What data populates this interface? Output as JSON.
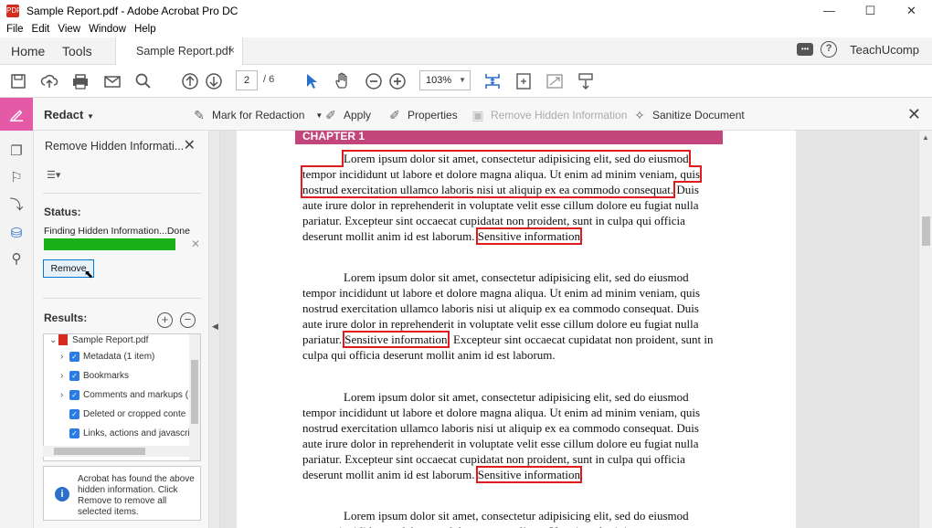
{
  "window": {
    "title": "Sample Report.pdf - Adobe Acrobat Pro DC",
    "app_icon_label": "PDF",
    "controls": {
      "minimize": "—",
      "maximize": "☐",
      "close": "✕"
    }
  },
  "menu": [
    "File",
    "Edit",
    "View",
    "Window",
    "Help"
  ],
  "tabs": {
    "home": "Home",
    "tools": "Tools",
    "document": "Sample Report.pdf",
    "close": "×",
    "user": "TeachUcomp"
  },
  "toolbar": {
    "page_current": "2",
    "page_total": "/ 6",
    "zoom": "103%",
    "icons": [
      "save-icon",
      "cloud-upload-icon",
      "print-icon",
      "email-icon",
      "search-icon",
      "page-up-icon",
      "page-down-icon",
      "select-arrow-icon",
      "hand-icon",
      "zoom-out-icon",
      "zoom-in-icon",
      "fit-page-icon",
      "full-screen-icon",
      "read-mode-icon",
      "scroll-mode-icon"
    ]
  },
  "redact_bar": {
    "label": "Redact",
    "mark": "Mark for Redaction",
    "apply": "Apply",
    "properties": "Properties",
    "remove_hidden": "Remove Hidden Information",
    "sanitize": "Sanitize Document",
    "close": "✕"
  },
  "panel": {
    "title": "Remove Hidden Informati...",
    "status_label": "Status:",
    "status_text": "Finding Hidden Information...Done",
    "progress": 1.0,
    "remove_button": "Remove",
    "results_label": "Results:",
    "tree": {
      "root": "Sample Report.pdf",
      "items": [
        "Metadata (1 item)",
        "Bookmarks",
        "Comments and markups (",
        "Deleted or cropped conte",
        "Links, actions and javascri"
      ]
    },
    "info": "Acrobat has found the above hidden information. Click Remove to remove all selected items."
  },
  "document": {
    "chapter": "CHAPTER 1",
    "para1": [
      {
        "t": "Lorem ipsum dolor sit amet, consectetur adipisicing elit, sed do eiusmod tempor incididunt ut labore et dolore magna aliqua. Ut enim ad minim veniam, quis nostrud exercitation ullamco laboris nisi ut aliquip ex ea commodo consequat.",
        "r": true
      },
      {
        "t": " Duis aute irure dolor in reprehenderit in voluptate velit esse cillum dolore eu fugiat nulla pariatur. Excepteur sint occaecat cupidatat non proident, sunt in culpa qui officia deserunt mollit anim id est laborum. ",
        "r": false
      },
      {
        "t": "Sensitive information",
        "r": true
      },
      {
        "t": ".",
        "r": false
      }
    ],
    "para2": [
      {
        "t": "Lorem ipsum dolor sit amet, consectetur adipisicing elit, sed do eiusmod tempor incididunt ut labore et dolore magna aliqua. Ut enim ad minim veniam, quis nostrud exercitation ullamco laboris nisi ut aliquip ex ea commodo consequat. Duis aute irure dolor in reprehenderit in voluptate velit esse cillum dolore eu fugiat nulla pariatur. ",
        "r": false
      },
      {
        "t": "Sensitive information",
        "r": true
      },
      {
        "t": ". Excepteur sint occaecat cupidatat non proident, sunt in culpa qui officia deserunt mollit anim id est laborum.",
        "r": false
      }
    ],
    "para3": [
      {
        "t": "Lorem ipsum dolor sit amet, consectetur adipisicing elit, sed do eiusmod tempor incididunt ut labore et dolore magna aliqua. Ut enim ad minim veniam, quis nostrud exercitation ullamco laboris nisi ut aliquip ex ea commodo consequat. Duis aute irure dolor in reprehenderit in voluptate velit esse cillum dolore eu fugiat nulla pariatur. Excepteur sint occaecat cupidatat non proident, sunt in culpa qui officia deserunt mollit anim id est laborum. ",
        "r": false
      },
      {
        "t": "Sensitive information",
        "r": true
      },
      {
        "t": ".",
        "r": false
      }
    ],
    "para4": [
      {
        "t": "Lorem ipsum dolor sit amet, consectetur adipisicing elit, sed do eiusmod tempor incididunt ut labore et dolore magna aliqua. Ut enim ad minim",
        "r": false
      }
    ]
  },
  "colors": {
    "redact_accent": "#e45aa7",
    "chapter_bar": "#c2457b",
    "redaction_box": "#e01b1b",
    "progress": "#19b019"
  }
}
